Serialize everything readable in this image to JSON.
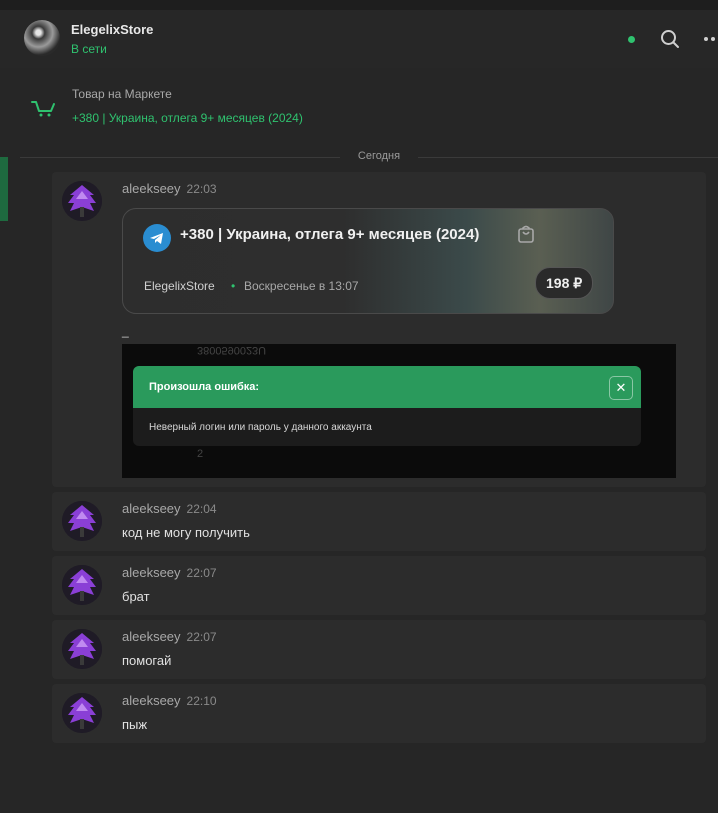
{
  "header": {
    "store_name": "ElegelixStore",
    "status": "В сети"
  },
  "product": {
    "label": "Товар на Маркете",
    "link": "+380 | Украина, отлега 9+ месяцев (2024)"
  },
  "divider": "Сегодня",
  "messages": [
    {
      "author": "aleekseey",
      "time": "22:03",
      "card": {
        "title": "+380 | Украина, отлега 9+ месяцев (2024)",
        "seller": "ElegelixStore",
        "dot": "•",
        "date": "Воскресенье в 13:07",
        "price": "198 ₽"
      },
      "text": "_",
      "screenshot": {
        "ghost_top": "3800590023U",
        "ghost_bottom": "2",
        "error_title": "Произошла ошибка:",
        "error_body": "Неверный логин или пароль у данного аккаунта",
        "close_glyph": "✕"
      }
    },
    {
      "author": "aleekseey",
      "time": "22:04",
      "text": "код не могу получить"
    },
    {
      "author": "aleekseey",
      "time": "22:07",
      "text": "брат"
    },
    {
      "author": "aleekseey",
      "time": "22:07",
      "text": "помогай"
    },
    {
      "author": "aleekseey",
      "time": "22:10",
      "text": "пыж"
    }
  ],
  "colors": {
    "accent": "#2fc26f",
    "error_header": "#2a9a5c",
    "telegram": "#2a8dd1"
  },
  "icons": [
    "search-icon",
    "more-icon",
    "cart-icon",
    "telegram-icon",
    "shopping-bag-icon",
    "close-icon"
  ]
}
